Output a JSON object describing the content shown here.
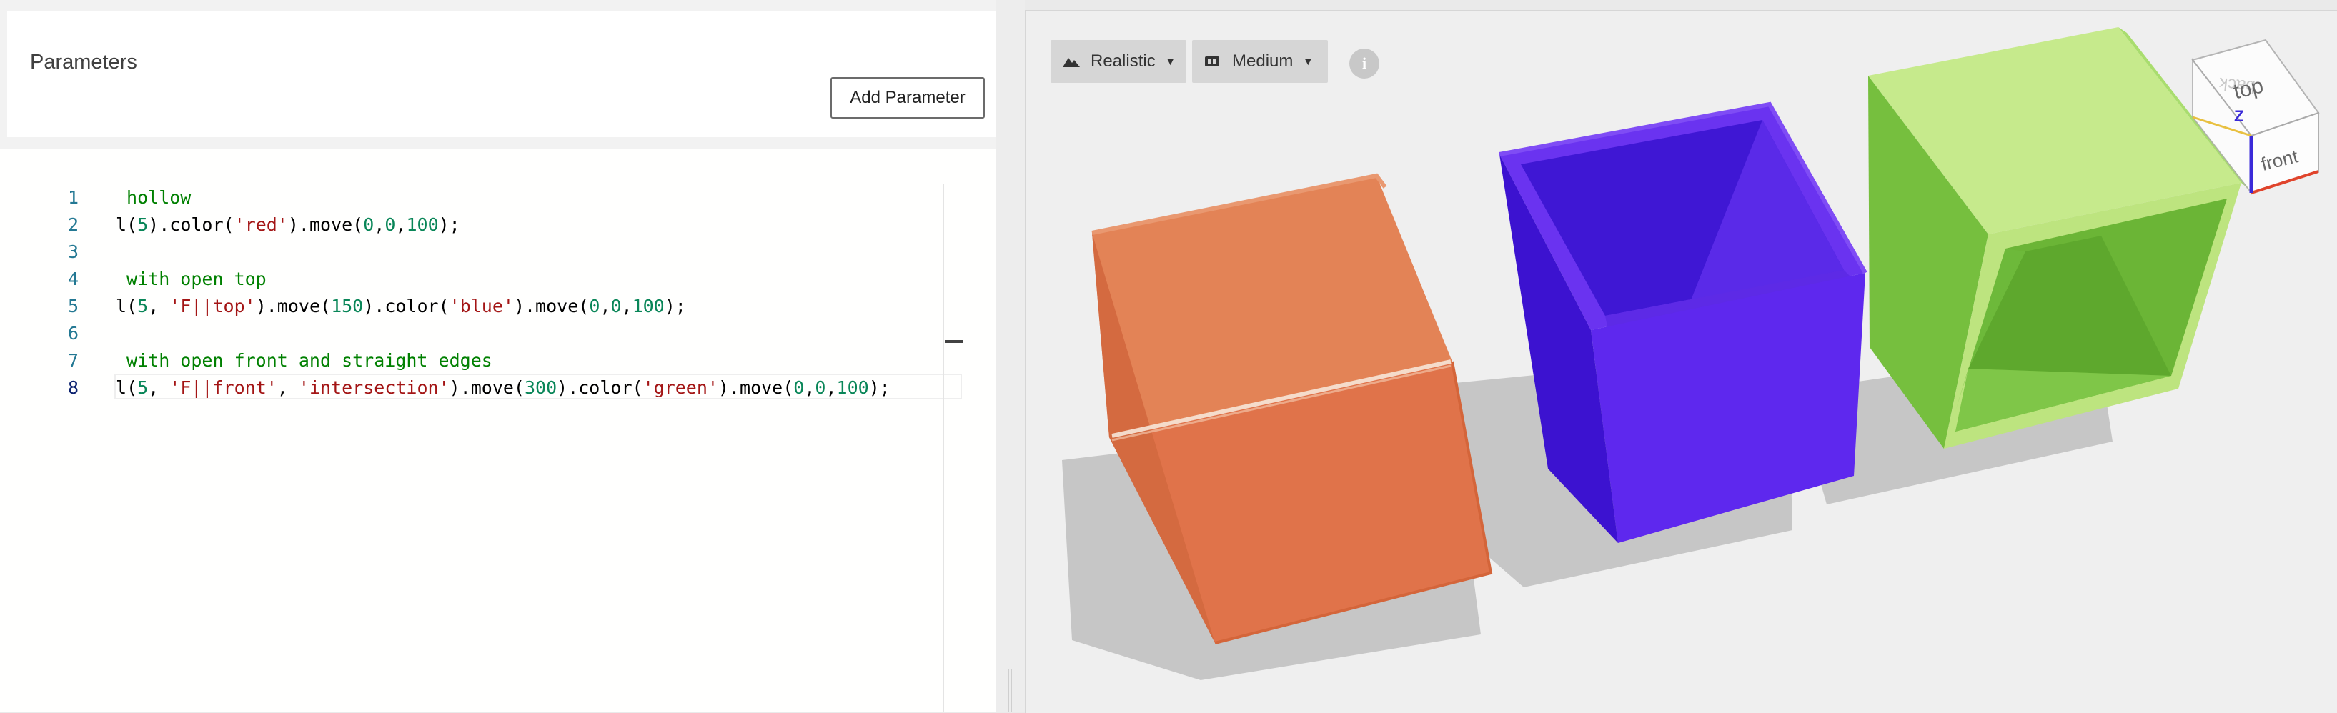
{
  "params": {
    "title": "Parameters",
    "add_button": "Add Parameter"
  },
  "editor": {
    "current_line": 8,
    "lines": [
      {
        "n": "1",
        "segments": [
          {
            "t": " hollow",
            "c": "cmt"
          }
        ]
      },
      {
        "n": "2",
        "segments": [
          {
            "t": "l("
          },
          {
            "t": "5",
            "c": "num"
          },
          {
            "t": ").color("
          },
          {
            "t": "'red'",
            "c": "str"
          },
          {
            "t": ").move("
          },
          {
            "t": "0",
            "c": "num"
          },
          {
            "t": ","
          },
          {
            "t": "0",
            "c": "num"
          },
          {
            "t": ","
          },
          {
            "t": "100",
            "c": "num"
          },
          {
            "t": ");"
          }
        ]
      },
      {
        "n": "3",
        "segments": []
      },
      {
        "n": "4",
        "segments": [
          {
            "t": " with open top",
            "c": "cmt"
          }
        ]
      },
      {
        "n": "5",
        "segments": [
          {
            "t": "l("
          },
          {
            "t": "5",
            "c": "num"
          },
          {
            "t": ", "
          },
          {
            "t": "'F||top'",
            "c": "str"
          },
          {
            "t": ").move("
          },
          {
            "t": "150",
            "c": "num"
          },
          {
            "t": ").color("
          },
          {
            "t": "'blue'",
            "c": "str"
          },
          {
            "t": ").move("
          },
          {
            "t": "0",
            "c": "num"
          },
          {
            "t": ","
          },
          {
            "t": "0",
            "c": "num"
          },
          {
            "t": ","
          },
          {
            "t": "100",
            "c": "num"
          },
          {
            "t": ");"
          }
        ]
      },
      {
        "n": "6",
        "segments": []
      },
      {
        "n": "7",
        "segments": [
          {
            "t": " with open front and straight edges",
            "c": "cmt"
          }
        ]
      },
      {
        "n": "8",
        "segments": [
          {
            "t": "l("
          },
          {
            "t": "5",
            "c": "num"
          },
          {
            "t": ", "
          },
          {
            "t": "'F||front'",
            "c": "str"
          },
          {
            "t": ", "
          },
          {
            "t": "'intersection'",
            "c": "str"
          },
          {
            "t": ").move("
          },
          {
            "t": "300",
            "c": "num"
          },
          {
            "t": ").color("
          },
          {
            "t": "'green'",
            "c": "str"
          },
          {
            "t": ").move("
          },
          {
            "t": "0",
            "c": "num"
          },
          {
            "t": ","
          },
          {
            "t": "0",
            "c": "num"
          },
          {
            "t": ","
          },
          {
            "t": "100",
            "c": "num"
          },
          {
            "t": ");"
          }
        ]
      }
    ]
  },
  "viewport": {
    "render_mode": "Realistic",
    "quality": "Medium",
    "info_label": "i",
    "view_cube": {
      "top": "top",
      "front": "front",
      "back": "back",
      "axis_z": "Z"
    }
  },
  "colors": {
    "red_cube": "#e07a4f",
    "blue_cube": "#5e28ee",
    "green_cube": "#7dc24a"
  }
}
